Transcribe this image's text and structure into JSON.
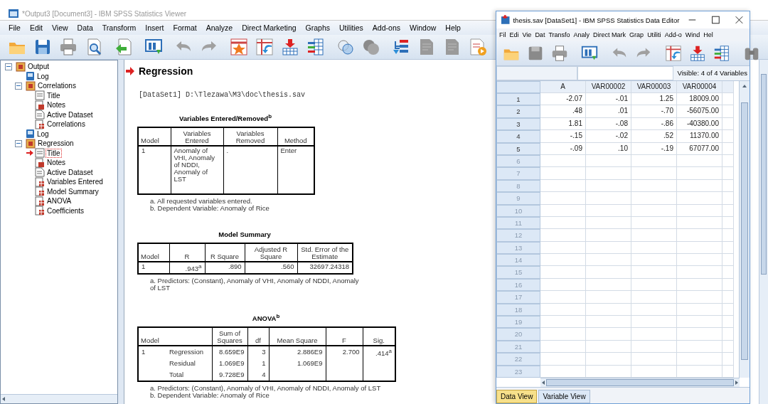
{
  "viewer": {
    "title": "*Output3 [Document3] - IBM SPSS Statistics Viewer",
    "menu": [
      "File",
      "Edit",
      "View",
      "Data",
      "Transform",
      "Insert",
      "Format",
      "Analyze",
      "Direct Marketing",
      "Graphs",
      "Utilities",
      "Add-ons",
      "Window",
      "Help"
    ],
    "outline": [
      {
        "label": "Output",
        "kind": "folder",
        "expanded": true,
        "selected": false,
        "children": [
          {
            "label": "Log",
            "kind": "log",
            "selected": false
          },
          {
            "label": "Correlations",
            "kind": "folder",
            "expanded": true,
            "selected": false,
            "children": [
              {
                "label": "Title",
                "kind": "title",
                "selected": false
              },
              {
                "label": "Notes",
                "kind": "notes",
                "selected": false
              },
              {
                "label": "Active Dataset",
                "kind": "dataset",
                "selected": false
              },
              {
                "label": "Correlations",
                "kind": "table",
                "selected": false
              }
            ]
          },
          {
            "label": "Log",
            "kind": "log",
            "selected": false
          },
          {
            "label": "Regression",
            "kind": "folder",
            "expanded": true,
            "selected": false,
            "children": [
              {
                "label": "Title",
                "kind": "title",
                "selected": true
              },
              {
                "label": "Notes",
                "kind": "notes",
                "selected": false
              },
              {
                "label": "Active Dataset",
                "kind": "dataset",
                "selected": false
              },
              {
                "label": "Variables Entered",
                "kind": "table",
                "selected": false
              },
              {
                "label": "Model Summary",
                "kind": "table",
                "selected": false
              },
              {
                "label": "ANOVA",
                "kind": "table",
                "selected": false
              },
              {
                "label": "Coefficients",
                "kind": "table",
                "selected": false
              }
            ]
          }
        ]
      }
    ],
    "heading": "Regression",
    "dataset_line": "[DataSet1] D:\\Tlezawa\\M3\\doc\\thesis.sav",
    "tables": [
      {
        "kind": "variables",
        "title": "Variables Entered/Removed$^{b}$",
        "columns": [
          {
            "label": "Model"
          },
          {
            "label": "Variables Entered"
          },
          {
            "label": "Variables Removed"
          },
          {
            "label": "Method"
          }
        ],
        "rows": [
          [
            "1",
            "Anomaly of VHI, Anomaly of NDDI, Anomaly of LST",
            ".",
            "Enter"
          ]
        ],
        "footnotes": [
          "a. All requested variables entered.",
          "b. Dependent Variable: Anomaly of Rice"
        ]
      },
      {
        "kind": "summary",
        "title": "Model Summary",
        "columns": [
          {
            "label": "Model"
          },
          {
            "label": "R"
          },
          {
            "label": "R Square"
          },
          {
            "label": "Adjusted R Square"
          },
          {
            "label": "Std. Error of the Estimate"
          }
        ],
        "rows": [
          [
            "1",
            ".943$^{a}$",
            ".890",
            ".560",
            "32697.24318"
          ]
        ],
        "footnotes": [
          "a. Predictors: (Constant), Anomaly of VHI, Anomaly of NDDI, Anomaly of LST"
        ]
      },
      {
        "kind": "anova",
        "title": "ANOVA$^{b}$",
        "columns": [
          {
            "label": "Model",
            "colspan": 2
          },
          {
            "label": "Sum of Squares"
          },
          {
            "label": "df"
          },
          {
            "label": "Mean Square"
          },
          {
            "label": "F"
          },
          {
            "label": "Sig."
          }
        ],
        "rows": [
          [
            "1",
            "Regression",
            "8.659E9",
            "3",
            "2.886E9",
            "2.700",
            ".414$^{a}$"
          ],
          [
            "",
            "Residual",
            "1.069E9",
            "1",
            "1.069E9",
            "",
            ""
          ],
          [
            "",
            "Total",
            "9.728E9",
            "4",
            "",
            "",
            ""
          ]
        ],
        "footnotes": [
          "a. Predictors: (Constant), Anomaly of VHI, Anomaly of NDDI, Anomaly of LST",
          "b. Dependent Variable: Anomaly of Rice"
        ]
      }
    ]
  },
  "editor": {
    "title": "thesis.sav [DataSet1] - IBM SPSS Statistics Data Editor",
    "menu": [
      "Fil",
      "Edi",
      "Vie",
      "Dat",
      "Transfo",
      "Analy",
      "Direct Mark",
      "Grap",
      "Utiliti",
      "Add-o",
      "Wind",
      "Hel"
    ],
    "visible": "Visible: 4 of 4 Variables",
    "columns": [
      "A",
      "VAR00002",
      "VAR00003",
      "VAR00004"
    ],
    "rows": [
      {
        "number": "1",
        "cells": [
          "-2.07",
          "-.01",
          "1.25",
          "18009.00"
        ]
      },
      {
        "number": "2",
        "cells": [
          ".48",
          ".01",
          "-.70",
          "-56075.00"
        ]
      },
      {
        "number": "3",
        "cells": [
          "1.81",
          "-.08",
          "-.86",
          "-40380.00"
        ]
      },
      {
        "number": "4",
        "cells": [
          "-.15",
          "-.02",
          ".52",
          "11370.00"
        ]
      },
      {
        "number": "5",
        "cells": [
          "-.09",
          ".10",
          "-.19",
          "67077.00"
        ]
      },
      {
        "number": "6"
      },
      {
        "number": "7"
      },
      {
        "number": "8"
      },
      {
        "number": "9"
      },
      {
        "number": "10"
      },
      {
        "number": "11"
      },
      {
        "number": "12"
      },
      {
        "number": "13"
      },
      {
        "number": "14"
      },
      {
        "number": "15"
      },
      {
        "number": "16"
      },
      {
        "number": "17"
      },
      {
        "number": "18"
      },
      {
        "number": "19"
      },
      {
        "number": "20"
      },
      {
        "number": "21"
      },
      {
        "number": "22"
      },
      {
        "number": "23"
      }
    ],
    "tabs": [
      {
        "label": "Data View",
        "selected": true
      },
      {
        "label": "Variable View",
        "selected": false
      }
    ]
  }
}
